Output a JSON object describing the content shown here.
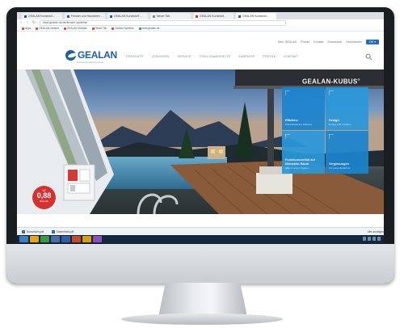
{
  "browser": {
    "tabs": [
      {
        "label": "GEALAN Kunststof...",
        "active": false
      },
      {
        "label": "Fenster und Haustüren ...",
        "active": false
      },
      {
        "label": "GEALAN Kunststoff ...",
        "active": false
      },
      {
        "label": "Neuer Tab",
        "active": false
      },
      {
        "label": "GEALAN Kunststof...",
        "active": false
      },
      {
        "label": "GEALAN Kunststof...",
        "active": true
      }
    ],
    "url": "www.gealan.de/de/fenster-systeme/",
    "bookmarks": [
      "Apps",
      "GEALAN Intranet",
      "GEALAN Kontakt",
      "Neuer Tab",
      "Gealan Systeme",
      "www.gealan.de"
    ]
  },
  "site": {
    "topnav": [
      "Über GEALAN",
      "Presse",
      "Kontakt",
      "Downloads",
      "Fachhändler"
    ],
    "lang_label": "DE ▾",
    "logo_text": "GEALAN",
    "tagline": "Kunststoff-Fenstersysteme",
    "mainnav": [
      "PRODUKTE",
      "LÖSUNGEN",
      "SERVICE",
      "STELLENANGEBOTE",
      "KARRIERE",
      "PRESSE",
      "KONTAKT"
    ]
  },
  "hero": {
    "badge_u": "Uf",
    "badge_value": "0,88",
    "badge_unit": "W/(m²K)",
    "kubus_title": "GEALAN-KUBUS",
    "kubus_mark": "®",
    "tiles": [
      {
        "title": "Effizienz",
        "sub": "Zukunftssichere Effizienz"
      },
      {
        "title": "Design",
        "sub": "Design trifft Funktion"
      },
      {
        "title": "Funktionsvielfalt auf kleinstem Raum",
        "sub": "Alles in einem System"
      },
      {
        "title": "Verglasungen",
        "sub": "Für jedes Bedürfnis"
      }
    ]
  },
  "downloads": {
    "items": [
      "Broschüre.pdf",
      "Datenblatt.pdf"
    ],
    "show_all": "Alle anzeigen"
  },
  "colors": {
    "brand_blue": "#1c5fa6",
    "tile_blue": "#1c84cf",
    "badge_red": "#d6302f"
  }
}
